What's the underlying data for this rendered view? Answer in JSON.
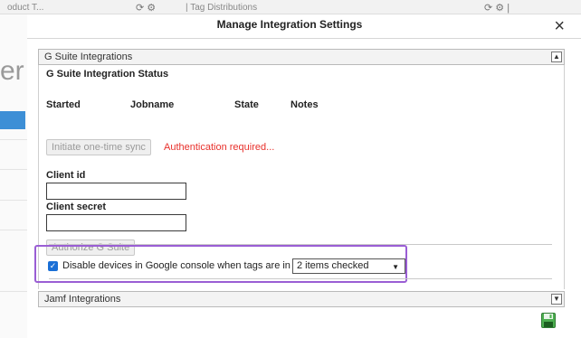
{
  "background": {
    "tab_text": "oduct T...",
    "tab2_text": "| Tag Distributions",
    "letter": "er"
  },
  "modal": {
    "title": "Manage Integration Settings",
    "close_label": "×"
  },
  "gsuite_panel": {
    "header": "G Suite Integrations",
    "status_title": "G Suite Integration Status",
    "columns": [
      "Started",
      "Jobname",
      "State",
      "Notes"
    ],
    "sync_button": "Initiate one-time sync",
    "auth_error": "Authentication required...",
    "client_id_label": "Client id",
    "client_id_value": "",
    "client_secret_label": "Client secret",
    "client_secret_value": "",
    "authorize_button": "Authorize G Suite",
    "disable_text": "Disable devices in Google console when tags are in a status of",
    "disable_checked": true,
    "status_select_value": "2 items checked"
  },
  "jamf_panel": {
    "header": "Jamf Integrations"
  },
  "colors": {
    "highlight": "#9a5ed4",
    "error": "#e8302b",
    "checkbox": "#1a6fd6",
    "save_icon": "#4caf50"
  }
}
